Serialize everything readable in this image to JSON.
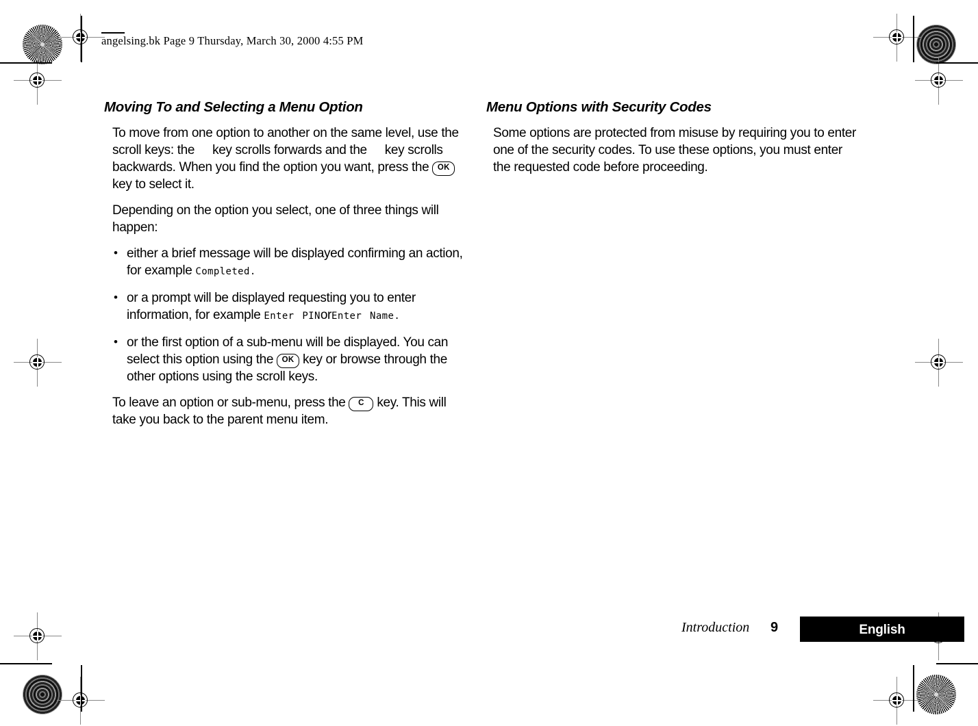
{
  "header": {
    "slug": "angelsing.bk  Page 9  Thursday, March 30, 2000  4:55 PM"
  },
  "left_column": {
    "heading": "Moving To and Selecting a Menu Option",
    "para_1": {
      "part_1": "To move from one option to another on the same level, use the scroll keys: the",
      "part_2": "key scrolls forwards and the",
      "part_3": "key scrolls backwards. When you find the option you want, press the",
      "key_ok": "OK",
      "part_4": "key to select it."
    },
    "para_2": "Depending on the option you select, one of three things will happen:",
    "bullets": [
      {
        "text_before": "either a brief message will be displayed confirming an action, for example",
        "lcd_1": "Completed.",
        "text_middle": "",
        "lcd_2": "",
        "text_after": ""
      },
      {
        "text_before": "or a prompt will be displayed requesting you to enter information, for example",
        "lcd_1": "Enter PIN",
        "text_middle": "or",
        "lcd_2": "Enter Name.",
        "text_after": ""
      },
      {
        "text_before": "or the first option of a sub-menu will be displayed. You can select this option using the",
        "key_ok": "OK",
        "text_after": "key or browse through the other options using the scroll keys."
      }
    ],
    "para_3": {
      "part_1": "To leave an option or sub-menu, press the",
      "key_c": "C",
      "part_2": "key. This will take you back to the parent menu item."
    }
  },
  "right_column": {
    "heading": "Menu Options with Security Codes",
    "para_1": "Some options are protected from misuse by requiring you to enter one of the security codes. To use these options, you must enter the requested code before proceeding."
  },
  "footer": {
    "chapter": "Introduction",
    "page_number": "9",
    "language": "English"
  },
  "colors": {
    "ink": "#000000",
    "paper": "#ffffff",
    "bar_background": "#000000",
    "bar_text": "#ffffff"
  }
}
